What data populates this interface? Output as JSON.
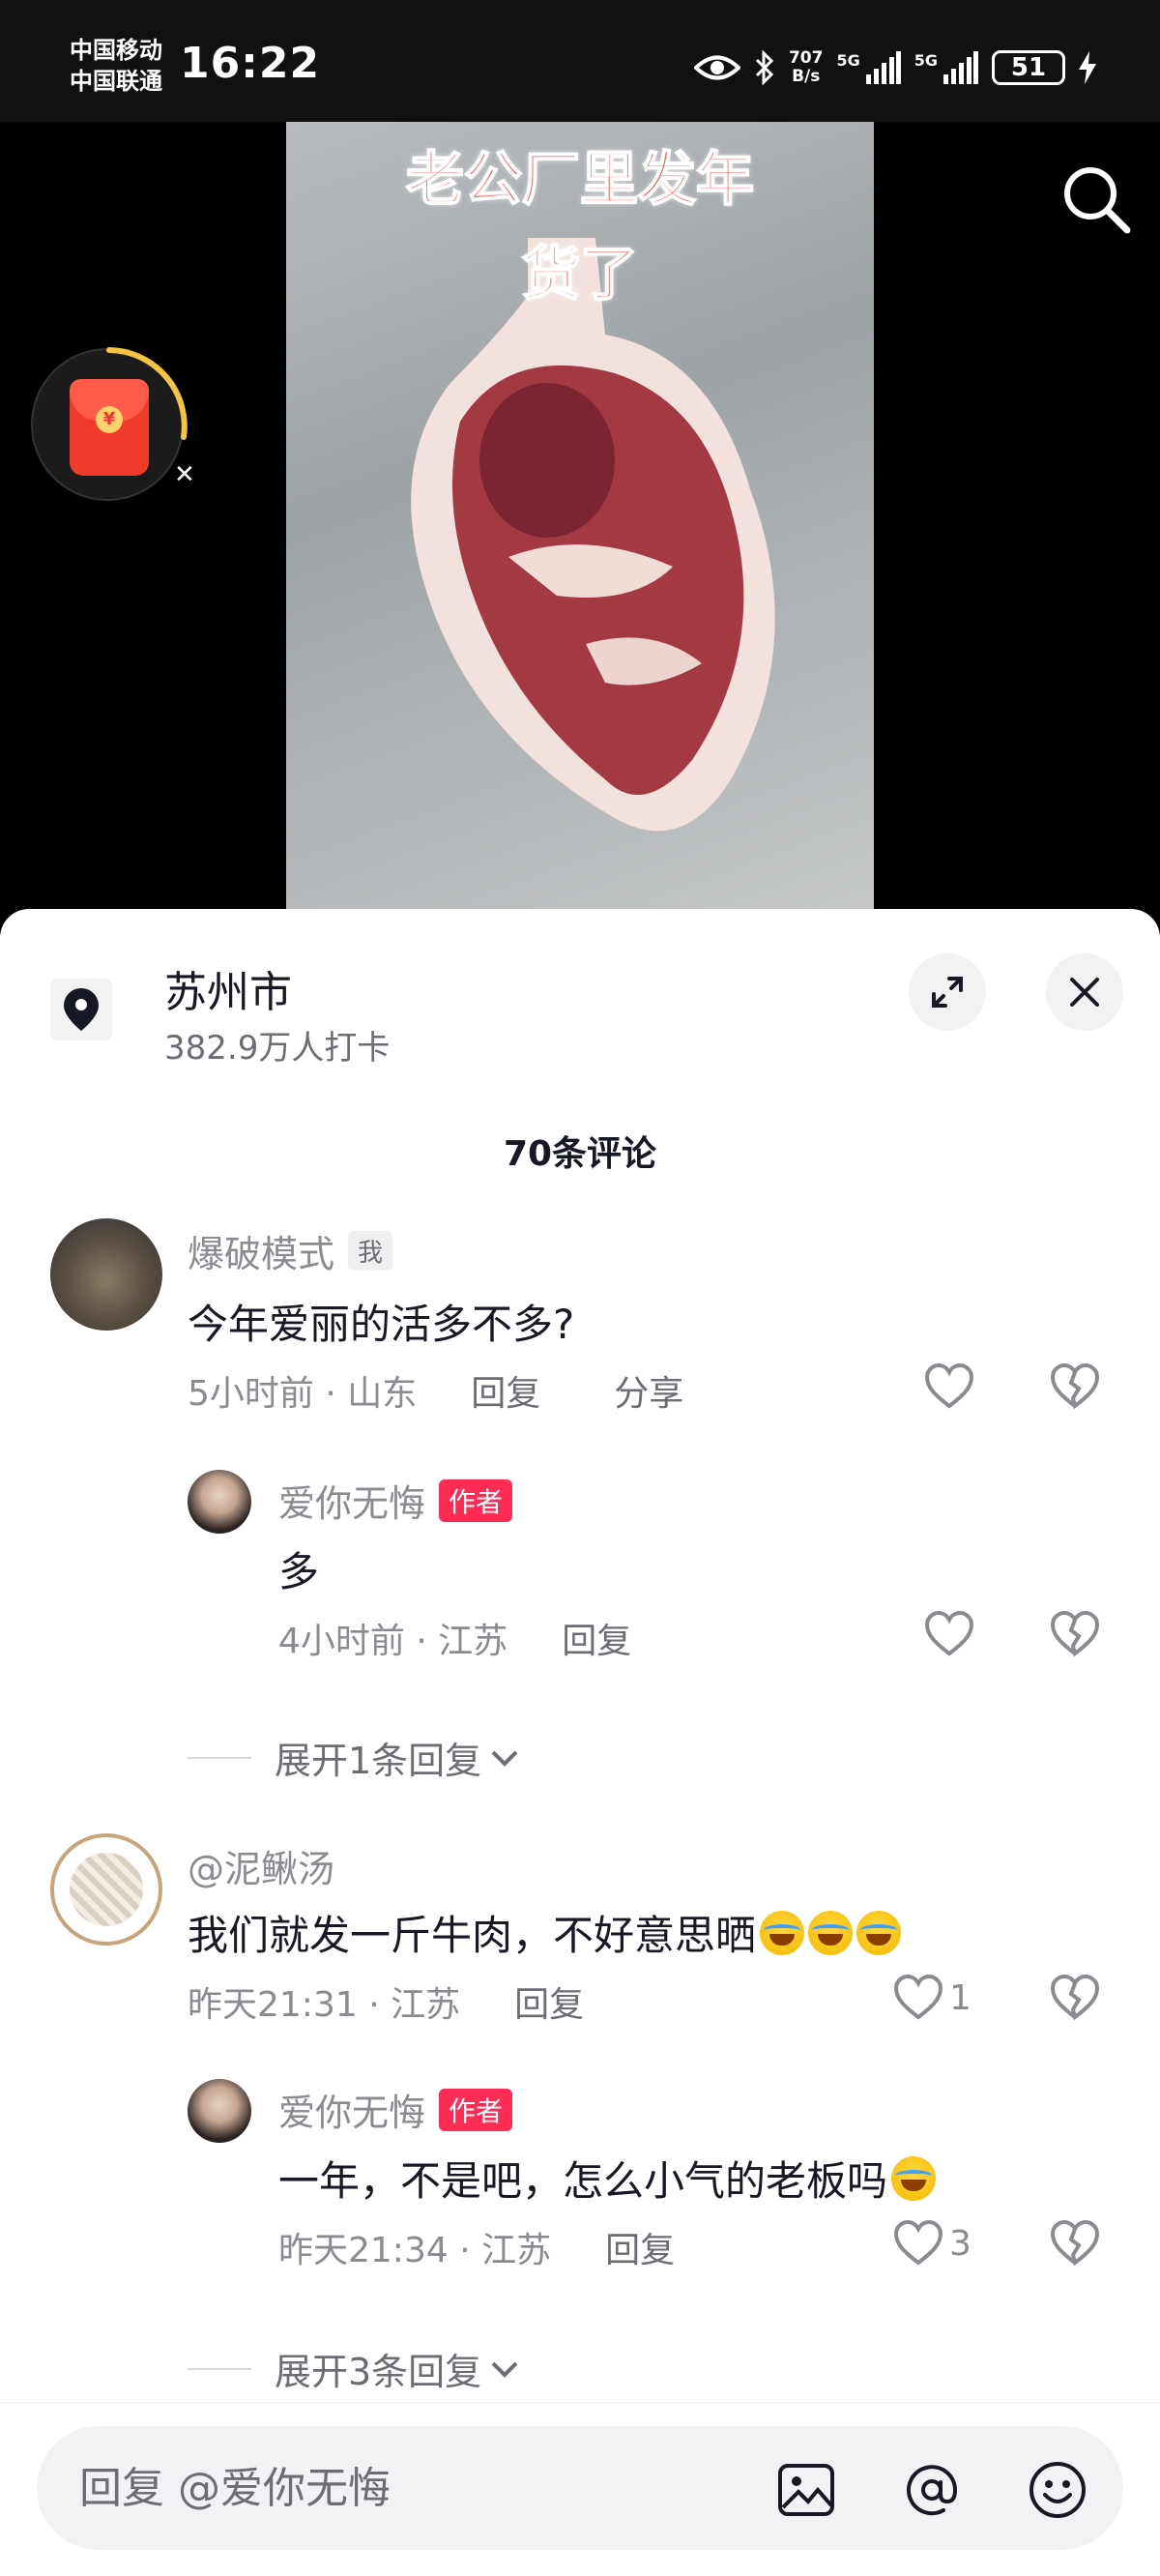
{
  "status_bar": {
    "carrier1": "中国移动",
    "carrier2": "中国联通",
    "time": "16:22",
    "net_speed_value": "707",
    "net_speed_unit": "B/s",
    "sig1_label": "5G",
    "sig2_label": "5G",
    "battery": "51"
  },
  "video": {
    "overlay_line1": "老公厂里发年",
    "overlay_line2": "货了"
  },
  "location": {
    "title": "苏州市",
    "subtitle": "382.9万人打卡"
  },
  "comments_header": "70条评论",
  "comments": [
    {
      "name": "爆破模式",
      "badge": "我",
      "text": "今年爱丽的活多不多?",
      "time_loc": "5小时前 · 山东",
      "reply": "回复",
      "share": "分享",
      "likes": ""
    },
    {
      "name": "爱你无悔",
      "badge": "作者",
      "text": "多",
      "time_loc": "4小时前 · 江苏",
      "reply": "回复",
      "likes": ""
    },
    {
      "name": "@泥鳅汤",
      "text": "我们就发一斤牛肉，不好意思晒",
      "time_loc": "昨天21:31 · 江苏",
      "reply": "回复",
      "likes": "1"
    },
    {
      "name": "爱你无悔",
      "badge": "作者",
      "text": "一年，不是吧，怎么小气的老板吗",
      "time_loc": "昨天21:34 · 江苏",
      "reply": "回复",
      "likes": "3"
    }
  ],
  "expand1": "展开1条回复",
  "expand2": "展开3条回复",
  "input": {
    "placeholder": "回复 @爱你无悔"
  },
  "colors": {
    "accent_red": "#fe2c55",
    "overlay_text": "#ff4b4b"
  },
  "icons": [
    "search-icon",
    "red-packet-icon",
    "location-pin-icon",
    "expand-icon",
    "close-icon",
    "heart-icon",
    "broken-heart-icon",
    "chevron-down-icon",
    "image-icon",
    "at-icon",
    "emoji-icon"
  ]
}
